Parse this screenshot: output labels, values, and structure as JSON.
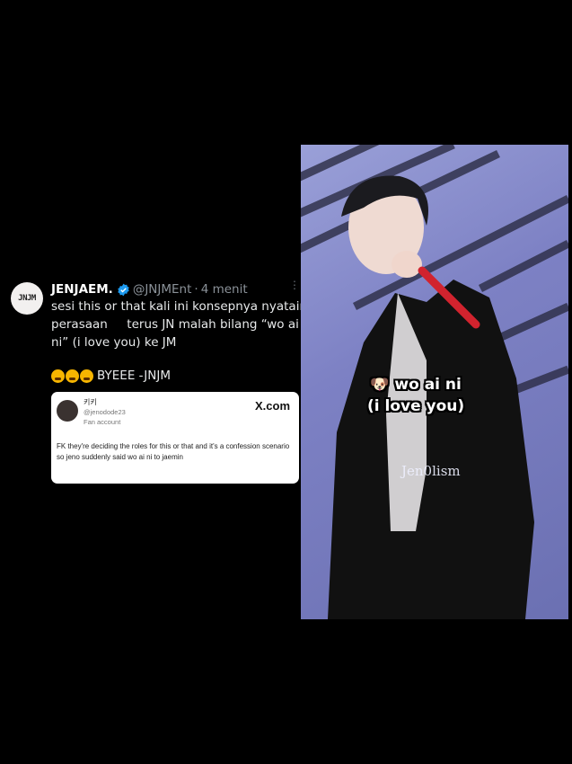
{
  "tweet": {
    "avatar_logo": "JNJM",
    "name": "JENJAEM.",
    "handle": "@JNJMEnt",
    "separator": "·",
    "time": "4 menit",
    "body": "sesi this or that kali ini konsepnya nyatain perasaan     terus JN malah bilang “wo ai ni” (i love you) ke JM",
    "sign_emoji": [
      "loudly-crying-face",
      "loudly-crying-face",
      "loudly-crying-face"
    ],
    "sign_text": "BYEEE -JNJM"
  },
  "quoted_card": {
    "name": "키키",
    "handle": "@jenodode23",
    "badge": "Fan account",
    "site": "X.com",
    "text": "FK they're deciding the roles for this or that and it's a confession scenario so jeno suddenly said wo ai ni to jaemin"
  },
  "photo": {
    "overlay_line1": "wo ai ni",
    "overlay_line2": "(i love you)",
    "watermark": "Jen0lism"
  },
  "colors": {
    "background": "#000000",
    "verified": "#1d9bf0",
    "photo_bg": "#7d81c4"
  }
}
